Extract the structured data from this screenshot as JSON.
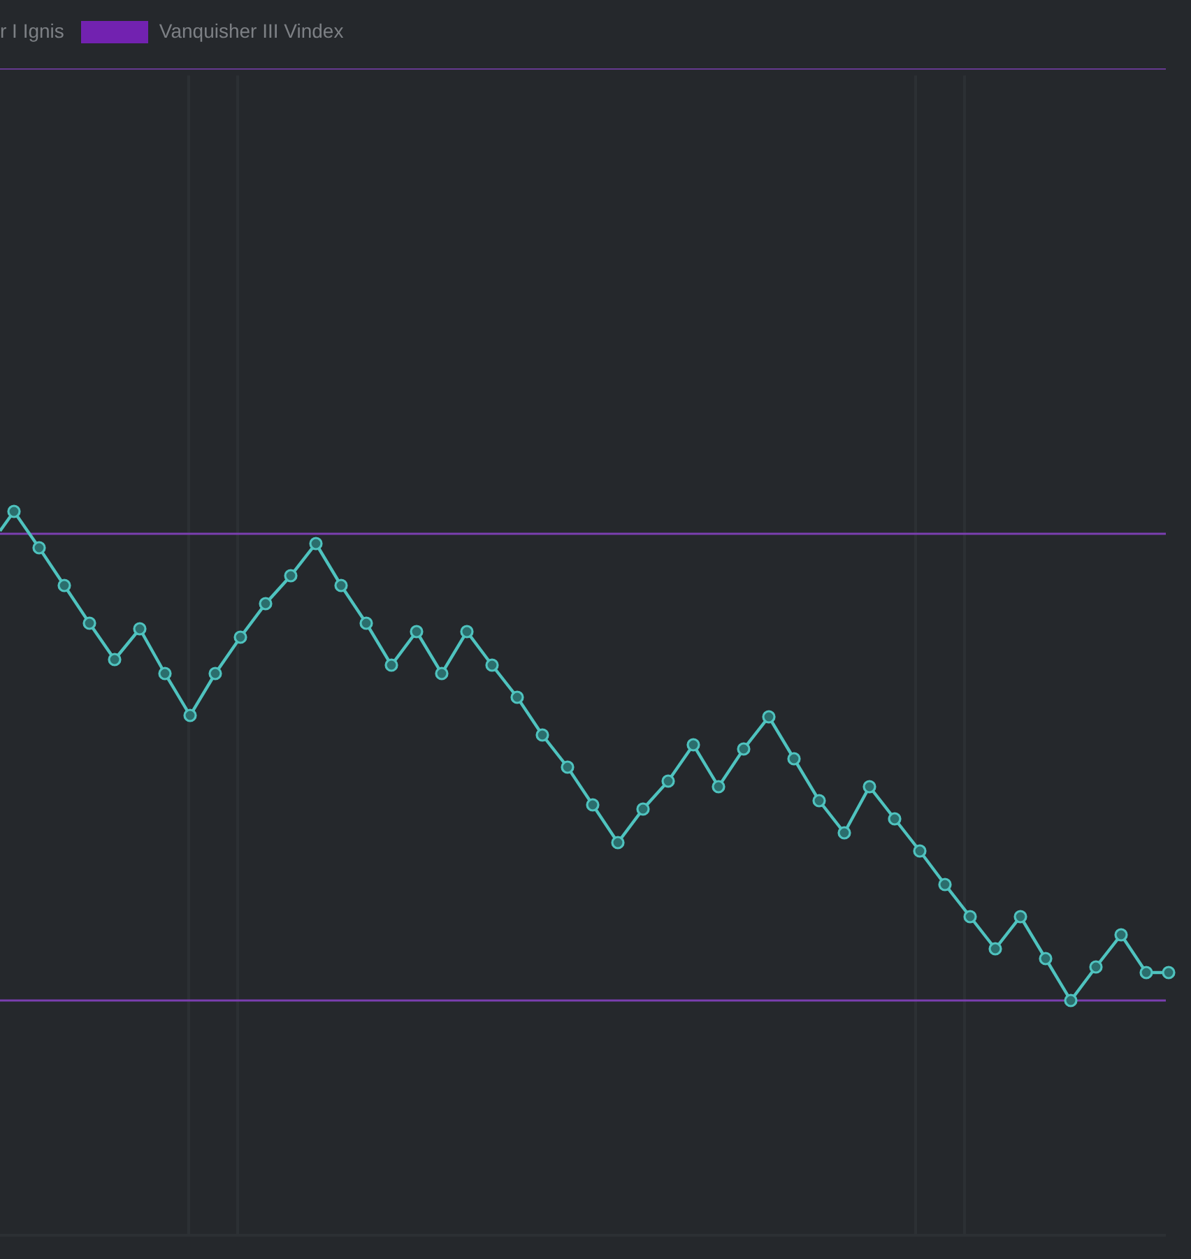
{
  "legend": [
    {
      "label": "r I Ignis"
    },
    {
      "label": "Vanquisher III Vindex",
      "color": "#7222b0"
    }
  ]
}
